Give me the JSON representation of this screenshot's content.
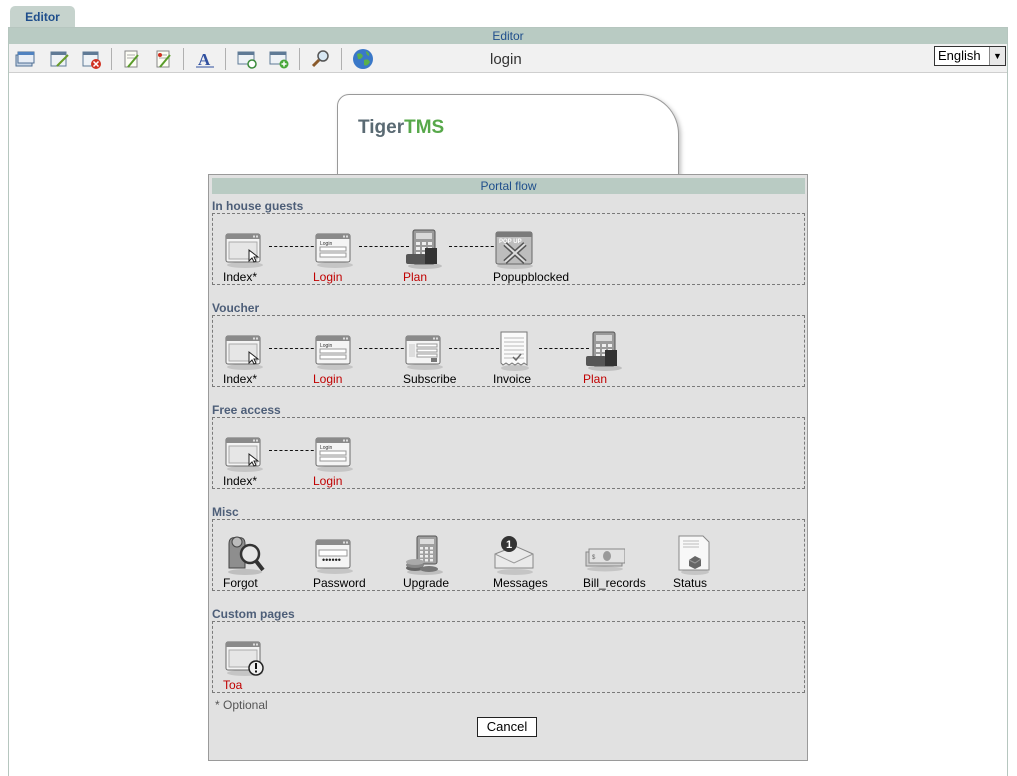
{
  "tabs": [
    {
      "label": "Editor"
    }
  ],
  "editor": {
    "header": "Editor",
    "page_name": "login",
    "language": "English",
    "toolbar_icons": [
      "pages-icon",
      "edit-page-icon",
      "delete-page-icon",
      "edit-text-icon",
      "edit-text-alt-icon",
      "font-icon",
      "page-settings-icon",
      "add-page-icon",
      "search-icon",
      "globe-icon"
    ]
  },
  "brand": {
    "part1": "Tiger",
    "part2": "TMS"
  },
  "modal": {
    "title": "Portal flow",
    "optional_note": "* Optional",
    "cancel_label": "Cancel",
    "sections": [
      {
        "title": "In house guests",
        "nodes": [
          {
            "label": "Index*",
            "icon": "browser-cursor-icon",
            "required": false
          },
          {
            "label": "Login",
            "icon": "login-window-icon",
            "required": true
          },
          {
            "label": "Plan",
            "icon": "plan-calculator-icon",
            "required": true
          },
          {
            "label": "Popupblocked",
            "icon": "popup-blocked-icon",
            "required": false
          }
        ]
      },
      {
        "title": "Voucher",
        "nodes": [
          {
            "label": "Index*",
            "icon": "browser-cursor-icon",
            "required": false
          },
          {
            "label": "Login",
            "icon": "login-window-icon",
            "required": true
          },
          {
            "label": "Subscribe",
            "icon": "subscribe-form-icon",
            "required": false
          },
          {
            "label": "Invoice",
            "icon": "invoice-icon",
            "required": false
          },
          {
            "label": "Plan",
            "icon": "plan-calculator-icon",
            "required": true
          }
        ]
      },
      {
        "title": "Free access",
        "nodes": [
          {
            "label": "Index*",
            "icon": "browser-cursor-icon",
            "required": false
          },
          {
            "label": "Login",
            "icon": "login-window-icon",
            "required": true
          }
        ]
      },
      {
        "title": "Misc",
        "nodes": [
          {
            "label": "Forgot",
            "icon": "forgot-magnifier-icon",
            "required": false
          },
          {
            "label": "Password",
            "icon": "password-window-icon",
            "required": false
          },
          {
            "label": "Upgrade",
            "icon": "upgrade-calculator-icon",
            "required": false
          },
          {
            "label": "Messages",
            "icon": "messages-envelope-icon",
            "required": false
          },
          {
            "label": "Bill_records",
            "icon": "bill-records-icon",
            "required": false
          },
          {
            "label": "Status",
            "icon": "status-chart-icon",
            "required": false
          }
        ]
      },
      {
        "title": "Custom pages",
        "nodes": [
          {
            "label": "Toa",
            "icon": "custom-page-warning-icon",
            "required": true
          }
        ]
      }
    ]
  }
}
